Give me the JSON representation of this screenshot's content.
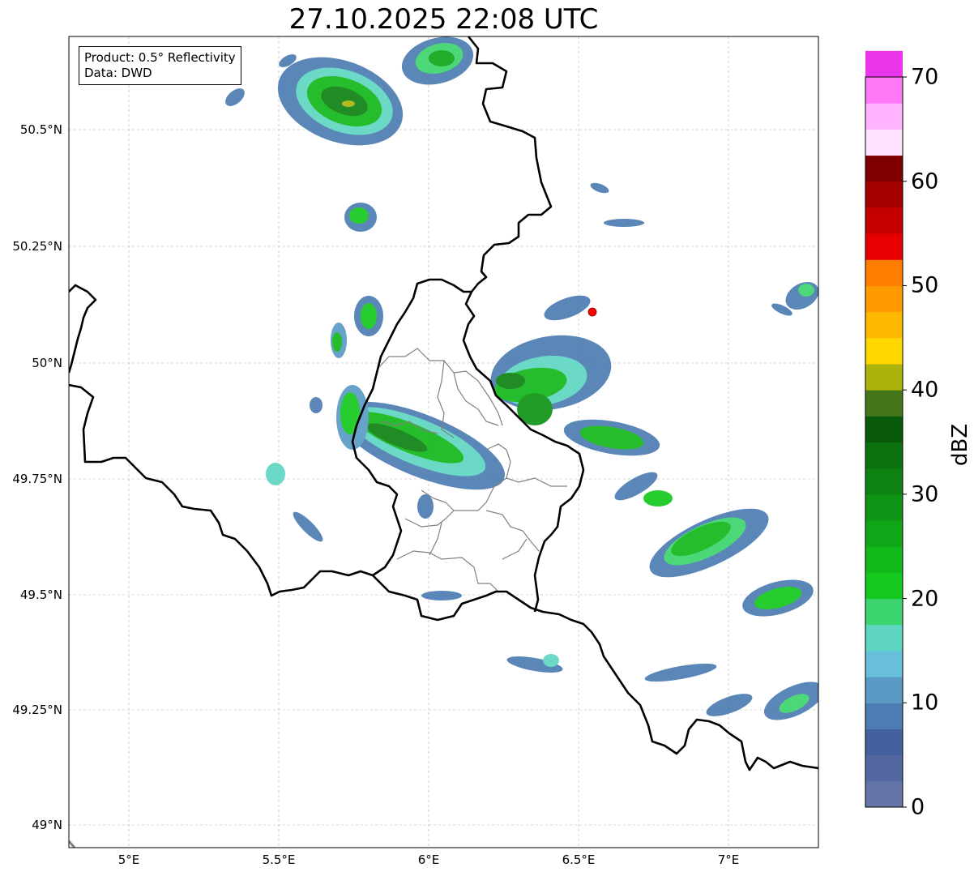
{
  "title": "27.10.2025 22:08 UTC",
  "info_box": {
    "line1": "Product: 0.5° Reflectivity",
    "line2": "Data: DWD"
  },
  "axes": {
    "y_ticks": [
      "50.5°N",
      "50.25°N",
      "50°N",
      "49.75°N",
      "49.5°N",
      "49.25°N",
      "49°N"
    ],
    "x_ticks": [
      "5°E",
      "5.5°E",
      "6°E",
      "6.5°E",
      "7°E"
    ],
    "lat_range": [
      48.95,
      50.7
    ],
    "lon_range": [
      4.8,
      7.3
    ],
    "grid": true
  },
  "colorbar": {
    "label": "dBZ",
    "ticks": [
      "0",
      "10",
      "20",
      "30",
      "40",
      "50",
      "60",
      "70"
    ],
    "range": [
      0,
      70
    ],
    "step": 2.5,
    "colors": [
      "#6374a8",
      "#5367a0",
      "#44619f",
      "#4c7cb2",
      "#5a9ac4",
      "#67bfdc",
      "#5fd6c2",
      "#3cd46e",
      "#14c91d",
      "#12b81a",
      "#10a617",
      "#0f9415",
      "#0e8213",
      "#0b700e",
      "#085a0a",
      "#46761a",
      "#adb30d",
      "#ffd800",
      "#ffb800",
      "#ff9a00",
      "#ff7e00",
      "#e80000",
      "#c60000",
      "#a40000",
      "#7e0000",
      "#ffe0ff",
      "#ffb3ff",
      "#ff78f5",
      "#ea36ea"
    ]
  },
  "radar_site": {
    "lon": 6.55,
    "lat": 50.11,
    "color": "#ff0000"
  }
}
